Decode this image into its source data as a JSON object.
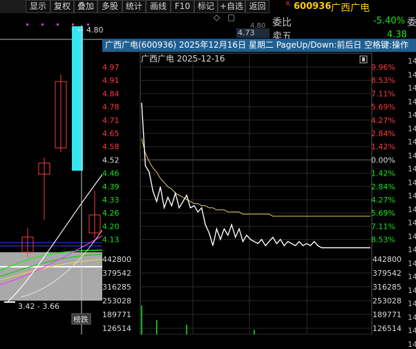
{
  "toolbar": {
    "items": [
      "显示",
      "复权",
      "叠加",
      "多股",
      "统计",
      "画线",
      "F10",
      "标记",
      "+自选",
      "返回"
    ]
  },
  "header": {
    "code_tag": "R",
    "code": "600936",
    "name": "广西广电",
    "weibi_label": "委比",
    "weibi_value": "-5.40%",
    "weibi_tail": "委",
    "maiwu_label": "卖五",
    "maiwu_value": "4.38",
    "price_box": "4.73",
    "price_box_hidden": "4.80"
  },
  "main_chart": {
    "high_label": "4.80",
    "range_label": "3.42 - 3.66",
    "tag": "榜跌"
  },
  "popup": {
    "title": "广西广电(600936)  2025年12月16日  星期二  PageUp/Down:前后日  空格键:操作",
    "inner_title": "广西广电   2025-12-16"
  },
  "edge_labels": [
    "14",
    "14",
    "14",
    "14",
    "14",
    "14",
    "14",
    "14",
    "14",
    "14",
    "14",
    "14",
    "14",
    "14",
    "14",
    "14",
    "14",
    "14",
    "14",
    "14",
    "14",
    "14"
  ],
  "chart_data": {
    "type": "line",
    "date": "2025-12-16",
    "price_ticks": [
      "4.97",
      "4.91",
      "4.84",
      "4.78",
      "4.71",
      "4.65",
      "4.58",
      "4.52",
      "4.46",
      "4.39",
      "4.33",
      "4.26",
      "4.20",
      "4.13"
    ],
    "pct_ticks": [
      "9.96%",
      "8.53%",
      "7.11%",
      "5.69%",
      "4.27%",
      "2.84%",
      "1.42%",
      "0.00%",
      "1.42%",
      "2.84%",
      "4.27%",
      "5.69%",
      "7.11%",
      "8.53%"
    ],
    "volume_ticks": [
      "442800",
      "379542",
      "316285",
      "253028",
      "189771",
      "126514"
    ],
    "ylim": [
      4.09,
      4.97
    ],
    "price_series": [
      4.8,
      4.5,
      4.47,
      4.38,
      4.33,
      4.4,
      4.3,
      4.35,
      4.31,
      4.37,
      4.3,
      4.33,
      4.36,
      4.3,
      4.31,
      4.28,
      4.3,
      4.22,
      4.18,
      4.12,
      4.2,
      4.15,
      4.2,
      4.17,
      4.22,
      4.16,
      4.2,
      4.14,
      4.17,
      4.15,
      4.14,
      4.13,
      4.15,
      4.12,
      4.14,
      4.16,
      4.13,
      4.15,
      4.12,
      4.14,
      4.13,
      4.12,
      4.14,
      4.12,
      4.13,
      4.12,
      4.14,
      4.12,
      4.11,
      4.11,
      4.11,
      4.11,
      4.11,
      4.11,
      4.11,
      4.11,
      4.11,
      4.11,
      4.11,
      4.11,
      4.11,
      4.11
    ],
    "avg_series": [
      4.63,
      4.56,
      4.52,
      4.49,
      4.47,
      4.44,
      4.42,
      4.4,
      4.39,
      4.37,
      4.36,
      4.35,
      4.34,
      4.33,
      4.32,
      4.32,
      4.31,
      4.31,
      4.3,
      4.3,
      4.29,
      4.29,
      4.29,
      4.28,
      4.28,
      4.28,
      4.28,
      4.27,
      4.27,
      4.27,
      4.27,
      4.27,
      4.27,
      4.27,
      4.27,
      4.26,
      4.26,
      4.26,
      4.26,
      4.26,
      4.26,
      4.26,
      4.26,
      4.26,
      4.26,
      4.26,
      4.26,
      4.26,
      4.26,
      4.26,
      4.26,
      4.26,
      4.26,
      4.26,
      4.26,
      4.26,
      4.26,
      4.26,
      4.26,
      4.26,
      4.26,
      4.26
    ]
  },
  "colors": {
    "up": "#ff3b3b",
    "down": "#19e619",
    "neutral": "#dddddd",
    "price_line": "#ffffff",
    "avg_line": "#e6d36a",
    "title_bar": "#1f5f91",
    "cyan_candle": "#35e6f0"
  }
}
